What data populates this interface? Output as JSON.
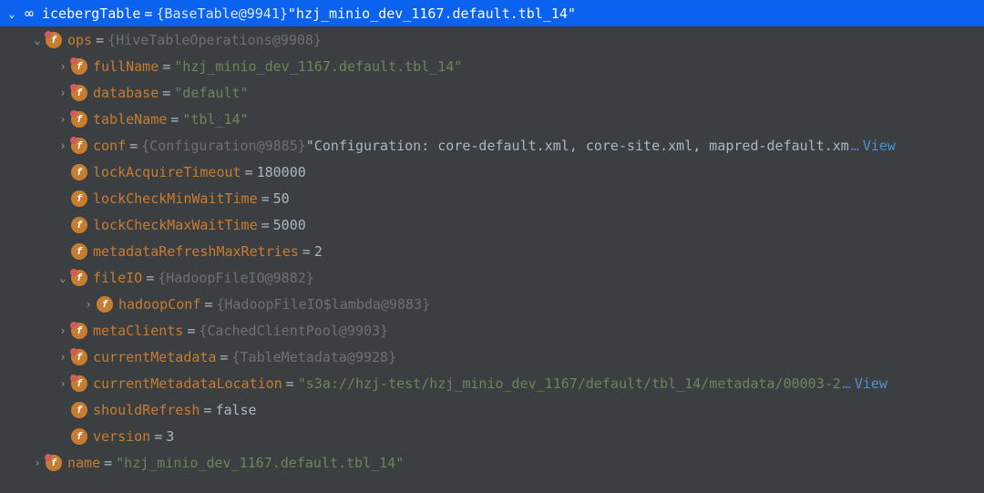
{
  "nodes": [
    {
      "level": 0,
      "arrow": "down",
      "badge": "infinity",
      "private": false,
      "name": "icebergTable",
      "ref": "{BaseTable@9941}",
      "valueType": "string",
      "value": "\"hzj_minio_dev_1167.default.tbl_14\"",
      "selected": true
    },
    {
      "level": 1,
      "arrow": "down",
      "badge": "f",
      "private": true,
      "name": "ops",
      "ref": "{HiveTableOperations@9908}",
      "valueType": "none",
      "value": ""
    },
    {
      "level": 2,
      "arrow": "right",
      "badge": "f",
      "private": true,
      "name": "fullName",
      "ref": "",
      "valueType": "string",
      "value": "\"hzj_minio_dev_1167.default.tbl_14\""
    },
    {
      "level": 2,
      "arrow": "right",
      "badge": "f",
      "private": true,
      "name": "database",
      "ref": "",
      "valueType": "string",
      "value": "\"default\""
    },
    {
      "level": 2,
      "arrow": "right",
      "badge": "f",
      "private": true,
      "name": "tableName",
      "ref": "",
      "valueType": "string",
      "value": "\"tbl_14\""
    },
    {
      "level": 2,
      "arrow": "right",
      "badge": "f",
      "private": true,
      "name": "conf",
      "ref": "{Configuration@9885}",
      "valueType": "plain",
      "value": "\"Configuration: core-default.xml, core-site.xml, mapred-default.xm",
      "ellipsis": true,
      "viewLink": "View"
    },
    {
      "level": 2,
      "arrow": "none",
      "badge": "f",
      "private": false,
      "name": "lockAcquireTimeout",
      "ref": "",
      "valueType": "plain",
      "value": "180000"
    },
    {
      "level": 2,
      "arrow": "none",
      "badge": "f",
      "private": false,
      "name": "lockCheckMinWaitTime",
      "ref": "",
      "valueType": "plain",
      "value": "50"
    },
    {
      "level": 2,
      "arrow": "none",
      "badge": "f",
      "private": false,
      "name": "lockCheckMaxWaitTime",
      "ref": "",
      "valueType": "plain",
      "value": "5000"
    },
    {
      "level": 2,
      "arrow": "none",
      "badge": "f",
      "private": false,
      "name": "metadataRefreshMaxRetries",
      "ref": "",
      "valueType": "plain",
      "value": "2"
    },
    {
      "level": 2,
      "arrow": "down",
      "badge": "f",
      "private": true,
      "name": "fileIO",
      "ref": "{HadoopFileIO@9882}",
      "valueType": "none",
      "value": ""
    },
    {
      "level": 3,
      "arrow": "right",
      "badge": "f",
      "private": false,
      "name": "hadoopConf",
      "ref": "{HadoopFileIO$lambda@9883}",
      "valueType": "none",
      "value": ""
    },
    {
      "level": 2,
      "arrow": "right",
      "badge": "f",
      "private": true,
      "name": "metaClients",
      "ref": "{CachedClientPool@9903}",
      "valueType": "none",
      "value": ""
    },
    {
      "level": 2,
      "arrow": "right",
      "badge": "f",
      "private": true,
      "name": "currentMetadata",
      "ref": "{TableMetadata@9928}",
      "valueType": "none",
      "value": ""
    },
    {
      "level": 2,
      "arrow": "right",
      "badge": "f",
      "private": true,
      "name": "currentMetadataLocation",
      "ref": "",
      "valueType": "string",
      "value": "\"s3a://hzj-test/hzj_minio_dev_1167/default/tbl_14/metadata/00003-2",
      "ellipsis": true,
      "viewLink": "View"
    },
    {
      "level": 2,
      "arrow": "none",
      "badge": "f",
      "private": false,
      "name": "shouldRefresh",
      "ref": "",
      "valueType": "plain",
      "value": "false"
    },
    {
      "level": 2,
      "arrow": "none",
      "badge": "f",
      "private": false,
      "name": "version",
      "ref": "",
      "valueType": "plain",
      "value": "3"
    },
    {
      "level": 1,
      "arrow": "right",
      "badge": "f",
      "private": true,
      "name": "name",
      "ref": "",
      "valueType": "string",
      "value": "\"hzj_minio_dev_1167.default.tbl_14\""
    }
  ],
  "glyphs": {
    "arrowDown": "⌄",
    "arrowRight": "›",
    "infinity": "∞",
    "ellipsis": "…"
  }
}
